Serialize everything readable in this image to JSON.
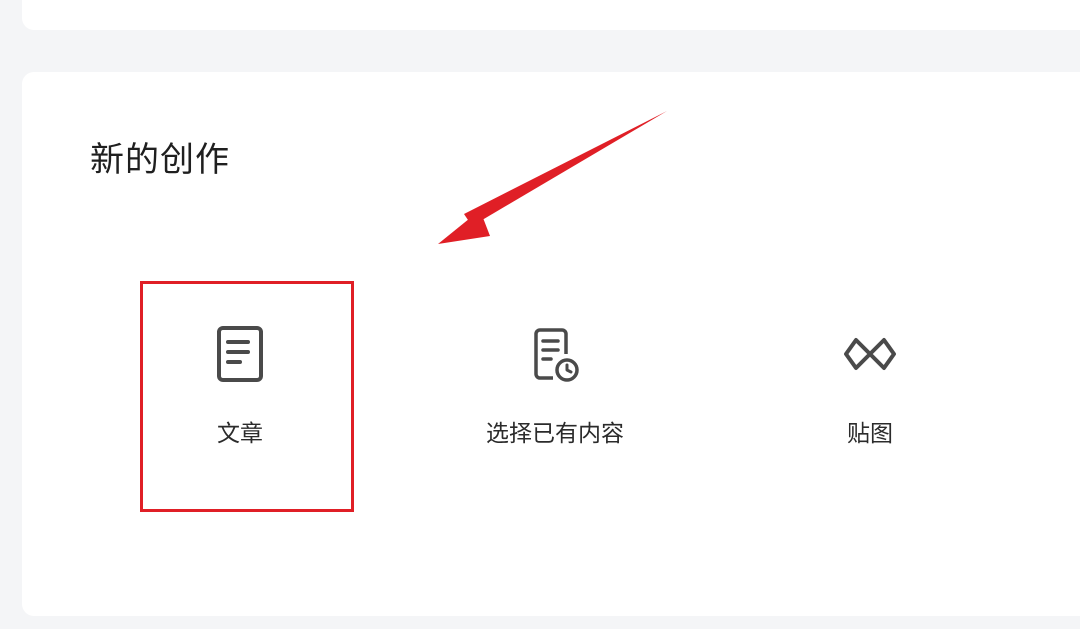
{
  "section": {
    "title": "新的创作"
  },
  "options": [
    {
      "label": "文章",
      "icon": "document-icon"
    },
    {
      "label": "选择已有内容",
      "icon": "document-clock-icon"
    },
    {
      "label": "贴图",
      "icon": "double-diamond-icon"
    }
  ],
  "annotations": {
    "highlight_color": "#e01f26",
    "arrow_color": "#e01f26"
  }
}
